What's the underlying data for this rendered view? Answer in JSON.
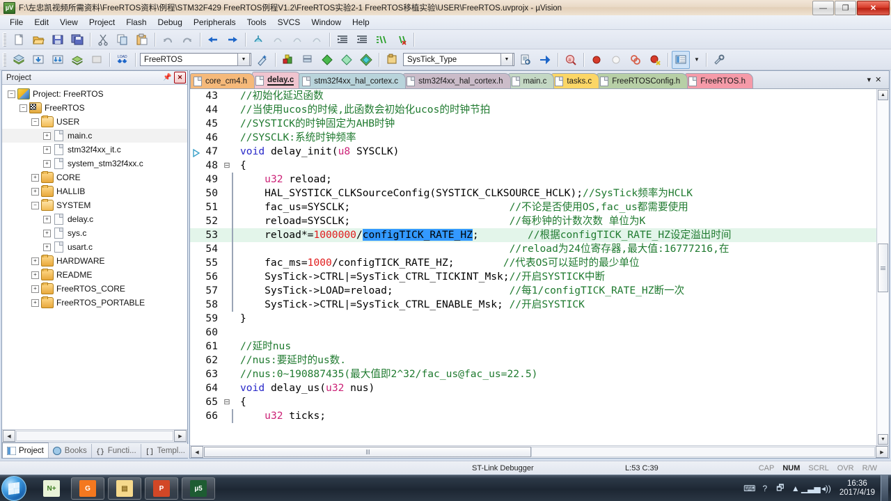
{
  "window": {
    "title": "F:\\左忠凯视频所需资料\\FreeRTOS资料\\例程\\STM32F429 FreeRTOS例程V1.2\\FreeRTOS实验2-1 FreeRTOS移植实验\\USER\\FreeRTOS.uvprojx - µVision",
    "app_icon_text": "µV",
    "minimize_label": "—",
    "maximize_label": "❐",
    "close_label": "✕"
  },
  "menubar": {
    "items": [
      "File",
      "Edit",
      "View",
      "Project",
      "Flash",
      "Debug",
      "Peripherals",
      "Tools",
      "SVCS",
      "Window",
      "Help"
    ]
  },
  "toolbar_row1": {
    "icons": [
      "new-file-icon",
      "open-file-icon",
      "save-icon",
      "save-all-icon",
      "cut-icon",
      "copy-icon",
      "paste-icon",
      "undo-icon",
      "redo-icon",
      "navigate-back-icon",
      "navigate-forward-icon",
      "bookmark-toggle-icon",
      "bookmark-prev-icon",
      "bookmark-next-icon",
      "bookmark-clear-icon",
      "indent-icon",
      "outdent-icon",
      "comment-icon",
      "uncomment-icon"
    ]
  },
  "toolbar_row2": {
    "icons": [
      "build-icon",
      "rebuild-icon",
      "batch-build-icon",
      "translate-icon",
      "stop-build-icon",
      "download-icon",
      "configure-wizard-icon",
      "target-options-icon",
      "manage-components-icon",
      "books-icon",
      "functions-icon",
      "templates-icon",
      "debug-session-icon",
      "insert-bookmark-icon",
      "find-in-files-icon",
      "breakpoint-icon",
      "disable-breakpoint-icon",
      "kill-all-breakpoints-icon",
      "window-layout-icon",
      "layout-dropdown-icon",
      "configure-icon"
    ],
    "target_combo": {
      "value": "FreeRTOS",
      "arrow": "▼"
    },
    "symbol_combo": {
      "value": "SysTick_Type",
      "arrow": "▼"
    }
  },
  "project_panel": {
    "title": "Project",
    "pin_icon": "pin-icon",
    "close_icon": "close-icon",
    "tree": [
      {
        "indent": 0,
        "expander": "−",
        "icon": "project",
        "label": "Project: FreeRTOS"
      },
      {
        "indent": 1,
        "expander": "−",
        "icon": "target",
        "label": "FreeRTOS"
      },
      {
        "indent": 2,
        "expander": "−",
        "icon": "folder-open",
        "label": "USER"
      },
      {
        "indent": 3,
        "expander": "+",
        "icon": "file",
        "label": "main.c",
        "selected": true
      },
      {
        "indent": 3,
        "expander": "+",
        "icon": "file",
        "label": "stm32f4xx_it.c"
      },
      {
        "indent": 3,
        "expander": "+",
        "icon": "file",
        "label": "system_stm32f4xx.c"
      },
      {
        "indent": 2,
        "expander": "+",
        "icon": "folder",
        "label": "CORE"
      },
      {
        "indent": 2,
        "expander": "+",
        "icon": "folder",
        "label": "HALLIB"
      },
      {
        "indent": 2,
        "expander": "−",
        "icon": "folder-open",
        "label": "SYSTEM"
      },
      {
        "indent": 3,
        "expander": "+",
        "icon": "file",
        "label": "delay.c"
      },
      {
        "indent": 3,
        "expander": "+",
        "icon": "file",
        "label": "sys.c"
      },
      {
        "indent": 3,
        "expander": "+",
        "icon": "file",
        "label": "usart.c"
      },
      {
        "indent": 2,
        "expander": "+",
        "icon": "folder",
        "label": "HARDWARE"
      },
      {
        "indent": 2,
        "expander": "+",
        "icon": "folder",
        "label": "README"
      },
      {
        "indent": 2,
        "expander": "+",
        "icon": "folder",
        "label": "FreeRTOS_CORE"
      },
      {
        "indent": 2,
        "expander": "+",
        "icon": "folder",
        "label": "FreeRTOS_PORTABLE"
      }
    ],
    "hscroll": {
      "left_arrow": "◀",
      "right_arrow": "▶"
    },
    "tabs": [
      {
        "label": "Project",
        "icon": "project-icon",
        "active": true
      },
      {
        "label": "Books",
        "icon": "books-icon",
        "active": false
      },
      {
        "label": "Functi...",
        "icon": "functions-icon",
        "active": false
      },
      {
        "label": "Templ...",
        "icon": "templates-icon",
        "active": false
      }
    ]
  },
  "editor": {
    "tabs": [
      {
        "label": "core_cm4.h",
        "color": "#f5b97a",
        "active": false
      },
      {
        "label": "delay.c",
        "color": "#f0c4cf",
        "active": true
      },
      {
        "label": "stm32f4xx_hal_cortex.c",
        "color": "#b9d4db",
        "active": false
      },
      {
        "label": "stm32f4xx_hal_cortex.h",
        "color": "#cbbcc9",
        "active": false
      },
      {
        "label": "main.c",
        "color": "#c4d8c4",
        "active": false
      },
      {
        "label": "tasks.c",
        "color": "#fbd666",
        "active": false
      },
      {
        "label": "FreeRTOSConfig.h",
        "color": "#b7cfa6",
        "active": false
      },
      {
        "label": "FreeRTOS.h",
        "color": "#f59aa8",
        "active": false
      }
    ],
    "tab_overflow_icon": "chevron-down-icon",
    "tab_close_icon": "close-icon",
    "lines": [
      {
        "n": 43,
        "fold": "",
        "bar": false,
        "run": false,
        "hl": false,
        "tokens": [
          {
            "t": "cm",
            "s": "//初始化延迟函数"
          }
        ]
      },
      {
        "n": 44,
        "fold": "",
        "bar": false,
        "run": false,
        "hl": false,
        "tokens": [
          {
            "t": "cm",
            "s": "//当使用ucos的时候,此函数会初始化ucos的时钟节拍"
          }
        ]
      },
      {
        "n": 45,
        "fold": "",
        "bar": false,
        "run": false,
        "hl": false,
        "tokens": [
          {
            "t": "cm",
            "s": "//SYSTICK的时钟固定为AHB时钟"
          }
        ]
      },
      {
        "n": 46,
        "fold": "",
        "bar": false,
        "run": false,
        "hl": false,
        "tokens": [
          {
            "t": "cm",
            "s": "//SYSCLK:系统时钟频率"
          }
        ]
      },
      {
        "n": 47,
        "fold": "",
        "bar": false,
        "run": true,
        "hl": false,
        "tokens": [
          {
            "t": "kw",
            "s": "void"
          },
          {
            "t": "",
            "s": " delay_init("
          },
          {
            "t": "ty",
            "s": "u8"
          },
          {
            "t": "",
            "s": " SYSCLK)"
          }
        ]
      },
      {
        "n": 48,
        "fold": "⊟",
        "bar": false,
        "run": false,
        "hl": false,
        "tokens": [
          {
            "t": "",
            "s": "{"
          }
        ]
      },
      {
        "n": 49,
        "fold": "",
        "bar": true,
        "run": false,
        "hl": false,
        "tokens": [
          {
            "t": "",
            "s": "    "
          },
          {
            "t": "ty",
            "s": "u32"
          },
          {
            "t": "",
            "s": " reload;"
          }
        ]
      },
      {
        "n": 50,
        "fold": "",
        "bar": true,
        "run": false,
        "hl": false,
        "tokens": [
          {
            "t": "",
            "s": "    HAL_SYSTICK_CLKSourceConfig(SYSTICK_CLKSOURCE_HCLK);"
          },
          {
            "t": "cm",
            "s": "//SysTick频率为HCLK"
          }
        ]
      },
      {
        "n": 51,
        "fold": "",
        "bar": true,
        "run": false,
        "hl": false,
        "tokens": [
          {
            "t": "",
            "s": "    fac_us=SYSCLK;                          "
          },
          {
            "t": "cm",
            "s": "//不论是否使用OS,fac_us都需要使用"
          }
        ]
      },
      {
        "n": 52,
        "fold": "",
        "bar": true,
        "run": false,
        "hl": false,
        "tokens": [
          {
            "t": "",
            "s": "    reload=SYSCLK;                          "
          },
          {
            "t": "cm",
            "s": "//每秒钟的计数次数 单位为K"
          }
        ]
      },
      {
        "n": 53,
        "fold": "",
        "bar": true,
        "run": false,
        "hl": true,
        "tokens": [
          {
            "t": "",
            "s": "    reload*="
          },
          {
            "t": "num",
            "s": "1000000"
          },
          {
            "t": "",
            "s": "/"
          },
          {
            "t": "sel",
            "s": "configTICK_RATE_HZ"
          },
          {
            "t": "",
            "s": ";        "
          },
          {
            "t": "cm",
            "s": "//根据configTICK_RATE_HZ设定溢出时间"
          }
        ]
      },
      {
        "n": 54,
        "fold": "",
        "bar": true,
        "run": false,
        "hl": false,
        "tokens": [
          {
            "t": "",
            "s": "                                            "
          },
          {
            "t": "cm",
            "s": "//reload为24位寄存器,最大值:16777216,在"
          }
        ]
      },
      {
        "n": 55,
        "fold": "",
        "bar": true,
        "run": false,
        "hl": false,
        "tokens": [
          {
            "t": "",
            "s": "    fac_ms="
          },
          {
            "t": "num",
            "s": "1000"
          },
          {
            "t": "",
            "s": "/configTICK_RATE_HZ;        "
          },
          {
            "t": "cm",
            "s": "//代表OS可以延时的最少单位"
          }
        ]
      },
      {
        "n": 56,
        "fold": "",
        "bar": true,
        "run": false,
        "hl": false,
        "tokens": [
          {
            "t": "",
            "s": "    SysTick->CTRL|=SysTick_CTRL_TICKINT_Msk;"
          },
          {
            "t": "cm",
            "s": "//开启SYSTICK中断"
          }
        ]
      },
      {
        "n": 57,
        "fold": "",
        "bar": true,
        "run": false,
        "hl": false,
        "tokens": [
          {
            "t": "",
            "s": "    SysTick->LOAD=reload;                   "
          },
          {
            "t": "cm",
            "s": "//每1/configTICK_RATE_HZ断一次"
          }
        ]
      },
      {
        "n": 58,
        "fold": "",
        "bar": true,
        "run": false,
        "hl": false,
        "tokens": [
          {
            "t": "",
            "s": "    SysTick->CTRL|=SysTick_CTRL_ENABLE_Msk; "
          },
          {
            "t": "cm",
            "s": "//开启SYSTICK"
          }
        ]
      },
      {
        "n": 59,
        "fold": "",
        "bar": false,
        "run": false,
        "hl": false,
        "tokens": [
          {
            "t": "",
            "s": "}"
          }
        ]
      },
      {
        "n": 60,
        "fold": "",
        "bar": false,
        "run": false,
        "hl": false,
        "tokens": [
          {
            "t": "",
            "s": ""
          }
        ]
      },
      {
        "n": 61,
        "fold": "",
        "bar": false,
        "run": false,
        "hl": false,
        "tokens": [
          {
            "t": "cm",
            "s": "//延时nus"
          }
        ]
      },
      {
        "n": 62,
        "fold": "",
        "bar": false,
        "run": false,
        "hl": false,
        "tokens": [
          {
            "t": "cm",
            "s": "//nus:要延时的us数."
          }
        ]
      },
      {
        "n": 63,
        "fold": "",
        "bar": false,
        "run": false,
        "hl": false,
        "tokens": [
          {
            "t": "cm",
            "s": "//nus:0~190887435(最大值即2^32/fac_us@fac_us=22.5)"
          }
        ]
      },
      {
        "n": 64,
        "fold": "",
        "bar": false,
        "run": false,
        "hl": false,
        "tokens": [
          {
            "t": "kw",
            "s": "void"
          },
          {
            "t": "",
            "s": " delay_us("
          },
          {
            "t": "ty",
            "s": "u32"
          },
          {
            "t": "",
            "s": " nus)"
          }
        ]
      },
      {
        "n": 65,
        "fold": "⊟",
        "bar": false,
        "run": false,
        "hl": false,
        "tokens": [
          {
            "t": "",
            "s": "{"
          }
        ]
      },
      {
        "n": 66,
        "fold": "",
        "bar": true,
        "run": false,
        "hl": false,
        "tokens": [
          {
            "t": "",
            "s": "    "
          },
          {
            "t": "ty",
            "s": "u32"
          },
          {
            "t": "",
            "s": " ticks;"
          }
        ]
      }
    ],
    "scroll": {
      "up_arrow": "▲",
      "down_arrow": "▼",
      "left_arrow": "◀",
      "right_arrow": "▶"
    }
  },
  "statusbar": {
    "debugger": "ST-Link Debugger",
    "position": "L:53 C:39",
    "indicators": [
      {
        "label": "CAP",
        "on": false
      },
      {
        "label": "NUM",
        "on": true
      },
      {
        "label": "SCRL",
        "on": false
      },
      {
        "label": "OVR",
        "on": false
      },
      {
        "label": "R/W",
        "on": false
      }
    ]
  },
  "taskbar": {
    "start_label": "start-orb",
    "items": [
      {
        "name": "notepadpp-taskbar-item",
        "glyph": "N+",
        "bg": "#e9f3d8",
        "fg": "#3a7a1d",
        "framed": false
      },
      {
        "name": "foxit-pdf-taskbar-item",
        "glyph": "G",
        "bg": "#f4781f",
        "fg": "#ffffff",
        "framed": true
      },
      {
        "name": "explorer-taskbar-item",
        "glyph": "▤",
        "bg": "#f6d98c",
        "fg": "#8a6a1e",
        "framed": true
      },
      {
        "name": "powerpoint-taskbar-item",
        "glyph": "P",
        "bg": "#d24726",
        "fg": "#ffffff",
        "framed": true
      },
      {
        "name": "keil-uvision-taskbar-item",
        "glyph": "µ5",
        "bg": "#1e5c32",
        "fg": "#ffffff",
        "framed": true
      }
    ],
    "tray": [
      {
        "name": "keyboard-layout-icon",
        "glyph": "⌨"
      },
      {
        "name": "help-icon",
        "glyph": "?"
      },
      {
        "name": "network-icon",
        "glyph": "🗗"
      },
      {
        "name": "show-hidden-icons-icon",
        "glyph": "▲"
      },
      {
        "name": "signal-icon",
        "glyph": "▁▃▅"
      },
      {
        "name": "volume-icon",
        "glyph": "◂))"
      }
    ],
    "clock_time": "16:36",
    "clock_date": "2017/4/19"
  }
}
